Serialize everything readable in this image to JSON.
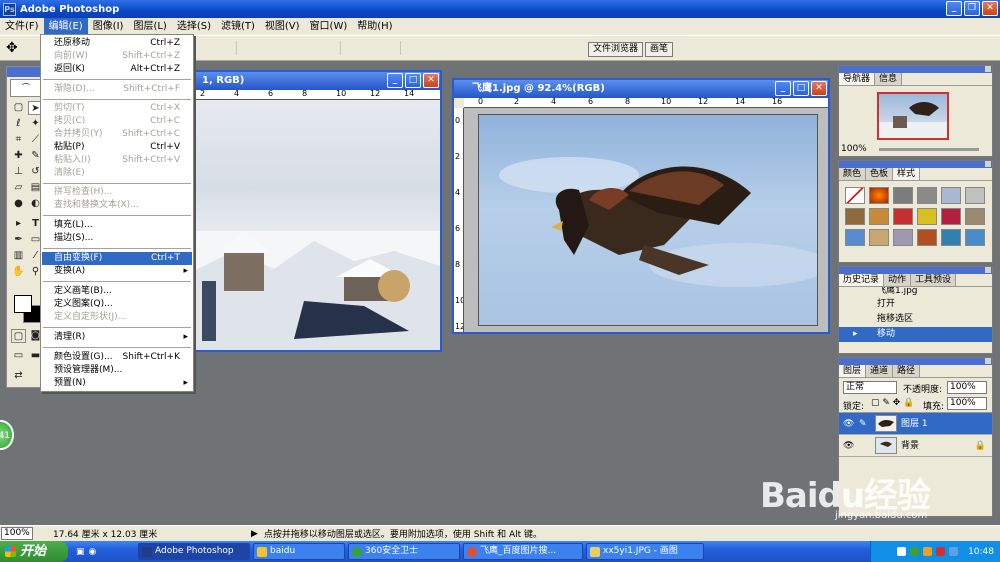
{
  "app": {
    "title": "Adobe Photoshop"
  },
  "menubar": [
    "文件(F)",
    "编辑(E)",
    "图像(I)",
    "图层(L)",
    "选择(S)",
    "滤镜(T)",
    "视图(V)",
    "窗口(W)",
    "帮助(H)"
  ],
  "options": {
    "palette_tabs": [
      "文件浏览器",
      "画笔"
    ]
  },
  "edit_menu": {
    "items": [
      {
        "label": "还原移动",
        "shortcut": "Ctrl+Z",
        "disabled": false
      },
      {
        "label": "向前(W)",
        "shortcut": "Shift+Ctrl+Z",
        "disabled": true
      },
      {
        "label": "返回(K)",
        "shortcut": "Alt+Ctrl+Z",
        "disabled": false
      },
      {
        "label": "渐隐(D)...",
        "shortcut": "Shift+Ctrl+F",
        "disabled": true
      },
      {
        "label": "剪切(T)",
        "shortcut": "Ctrl+X",
        "disabled": true
      },
      {
        "label": "拷贝(C)",
        "shortcut": "Ctrl+C",
        "disabled": true
      },
      {
        "label": "合并拷贝(Y)",
        "shortcut": "Shift+Ctrl+C",
        "disabled": true
      },
      {
        "label": "粘贴(P)",
        "shortcut": "Ctrl+V",
        "disabled": false
      },
      {
        "label": "粘贴入(I)",
        "shortcut": "Shift+Ctrl+V",
        "disabled": true
      },
      {
        "label": "清除(E)",
        "shortcut": "",
        "disabled": true
      },
      {
        "label": "拼写检查(H)...",
        "shortcut": "",
        "disabled": true
      },
      {
        "label": "查找和替换文本(X)...",
        "shortcut": "",
        "disabled": true
      },
      {
        "label": "填充(L)...",
        "shortcut": "",
        "disabled": false
      },
      {
        "label": "描边(S)...",
        "shortcut": "",
        "disabled": false
      },
      {
        "label": "自由变换(F)",
        "shortcut": "Ctrl+T",
        "disabled": false,
        "highlighted": true
      },
      {
        "label": "变换(A)",
        "shortcut": "",
        "disabled": false,
        "submenu": true
      },
      {
        "label": "定义画笔(B)...",
        "shortcut": "",
        "disabled": false
      },
      {
        "label": "定义图案(Q)...",
        "shortcut": "",
        "disabled": false
      },
      {
        "label": "定义自定形状(J)...",
        "shortcut": "",
        "disabled": true
      },
      {
        "label": "清理(R)",
        "shortcut": "",
        "disabled": false,
        "submenu": true
      },
      {
        "label": "颜色设置(G)...",
        "shortcut": "Shift+Ctrl+K",
        "disabled": false
      },
      {
        "label": "预设管理器(M)...",
        "shortcut": "",
        "disabled": false
      },
      {
        "label": "预置(N)",
        "shortcut": "",
        "disabled": false,
        "submenu": true
      }
    ]
  },
  "doc1": {
    "title": "1, RGB)",
    "ruler_h": [
      "2",
      "4",
      "6",
      "8",
      "10",
      "12",
      "14"
    ]
  },
  "doc2": {
    "title": "飞鹰1.jpg @ 92.4%(RGB)",
    "ruler_h": [
      "0",
      "2",
      "4",
      "6",
      "8",
      "10",
      "12",
      "14",
      "16"
    ],
    "ruler_v": [
      "0",
      "2",
      "4",
      "6",
      "8",
      "10",
      "12"
    ]
  },
  "navigator": {
    "tabs": [
      "导航器",
      "信息"
    ],
    "zoom": "100%"
  },
  "styles": {
    "tabs": [
      "颜色",
      "色板",
      "样式"
    ]
  },
  "history": {
    "tabs": [
      "历史记录",
      "动作",
      "工具预设"
    ],
    "rows": [
      "飞鹰1.jpg",
      "打开",
      "拖移选区",
      "移动"
    ]
  },
  "layers": {
    "tabs": [
      "图层",
      "通道",
      "路径"
    ],
    "blend_mode": "正常",
    "opacity_label": "不透明度:",
    "opacity": "100%",
    "lock_label": "锁定:",
    "fill_label": "填充:",
    "fill": "100%",
    "rows": [
      {
        "name": "图层 1"
      },
      {
        "name": "背景"
      }
    ]
  },
  "status": {
    "zoom": "100%",
    "doc_size": "17.64 厘米 x 12.03 厘米",
    "hint": "点按并拖移以移动图层或选区。要用附加选项，使用 Shift 和 Alt 键。"
  },
  "taskbar": {
    "start": "开始",
    "tasks": [
      "Adobe Photoshop",
      "baidu",
      "360安全卫士",
      "飞鹰_百度图片搜...",
      "xx5yi1.JPG - 画图"
    ],
    "clock": "10:48"
  },
  "watermark": {
    "text": "Baidu经验",
    "url": "jingyan.baidu.com"
  },
  "badge": "41"
}
